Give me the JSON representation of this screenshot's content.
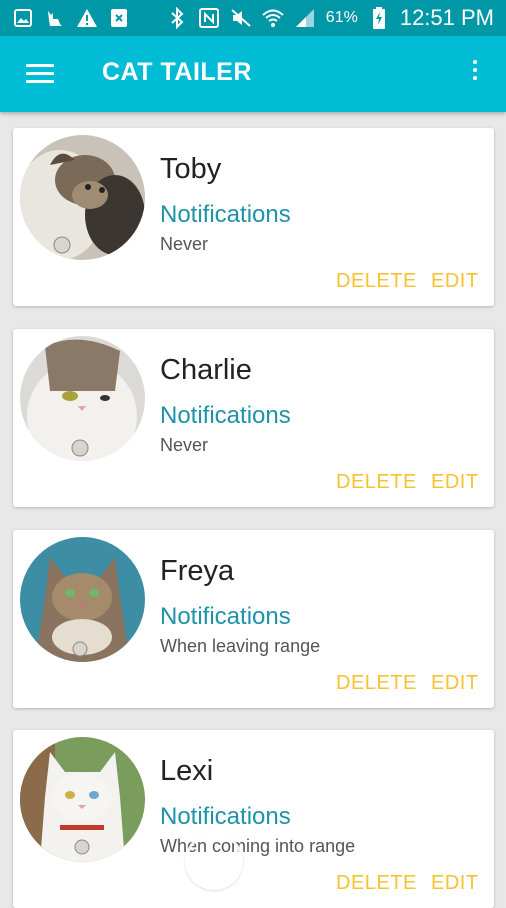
{
  "status_bar": {
    "battery": "61%",
    "time": "12:51 PM",
    "icons_left": [
      "image-icon",
      "cat-icon",
      "warning-icon",
      "file-close-icon"
    ],
    "icons_right": [
      "bluetooth-icon",
      "nfc-icon",
      "mute-icon",
      "wifi-icon",
      "signal-icon",
      "battery-charging-icon"
    ]
  },
  "app_bar": {
    "title": "CAT TAILER",
    "menu_icon": "hamburger-menu-icon",
    "overflow_icon": "more-vert-icon"
  },
  "cats": [
    {
      "name": "Toby",
      "notifications_label": "Notifications",
      "notifications_value": "Never",
      "delete_label": "DELETE",
      "edit_label": "EDIT"
    },
    {
      "name": "Charlie",
      "notifications_label": "Notifications",
      "notifications_value": "Never",
      "delete_label": "DELETE",
      "edit_label": "EDIT"
    },
    {
      "name": "Freya",
      "notifications_label": "Notifications",
      "notifications_value": "When leaving range",
      "delete_label": "DELETE",
      "edit_label": "EDIT"
    },
    {
      "name": "Lexi",
      "notifications_label": "Notifications",
      "notifications_value": "When coming into range",
      "delete_label": "DELETE",
      "edit_label": "EDIT"
    }
  ],
  "colors": {
    "status_bar": "#0097a7",
    "app_bar": "#00bcd4",
    "accent_link": "#1e93a8",
    "action_button": "#f7c12f",
    "background": "#e8e8e8"
  }
}
